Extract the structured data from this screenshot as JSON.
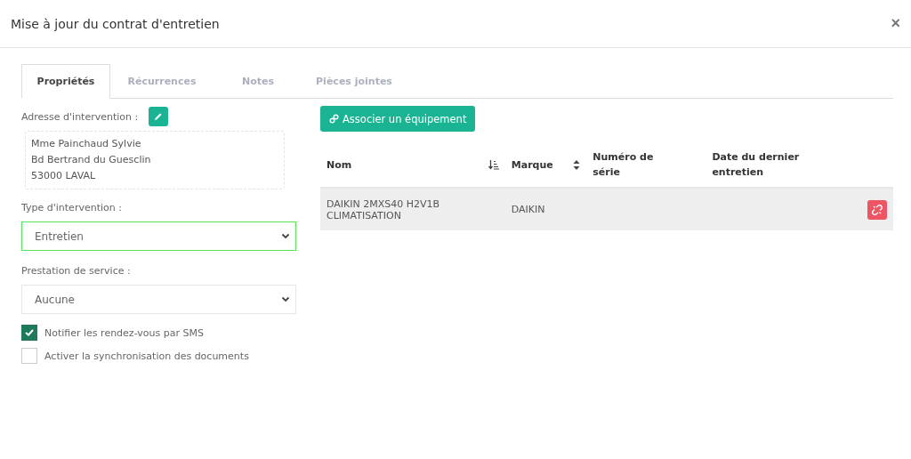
{
  "window": {
    "title": "Mise à jour du contrat d'entretien",
    "close": "×"
  },
  "tabs": [
    {
      "label": "Propriétés",
      "selected": true
    },
    {
      "label": "Récurrences",
      "selected": false
    },
    {
      "label": "Notes",
      "selected": false
    },
    {
      "label": "Pièces jointes",
      "selected": false
    }
  ],
  "address": {
    "label": "Adresse d'intervention :",
    "lines": [
      "Mme Painchaud Sylvie",
      "Bd Bertrand du Guesclin",
      "53000 LAVAL"
    ]
  },
  "intervention_type": {
    "label": "Type d'intervention :",
    "value": "Entretien",
    "focused": true
  },
  "service": {
    "label": "Prestation de service :",
    "value": "Aucune",
    "focused": false
  },
  "options": [
    {
      "label": "Notifier les rendez-vous par SMS",
      "checked": true
    },
    {
      "label": "Activer la synchronisation des documents",
      "checked": false
    }
  ],
  "associate_button": "Associer un équipement",
  "table": {
    "columns": [
      {
        "label": "Nom",
        "sortable": true,
        "sorted": true
      },
      {
        "label": "Marque",
        "sortable": true,
        "sorted": false
      },
      {
        "label": "Numéro de série",
        "sortable": false
      },
      {
        "label": "Date du dernier entretien",
        "sortable": false
      }
    ],
    "rows": [
      {
        "cells": [
          "DAIKIN 2MXS40 H2V1B CLIMATISATION",
          "DAIKIN",
          "",
          ""
        ]
      }
    ]
  }
}
